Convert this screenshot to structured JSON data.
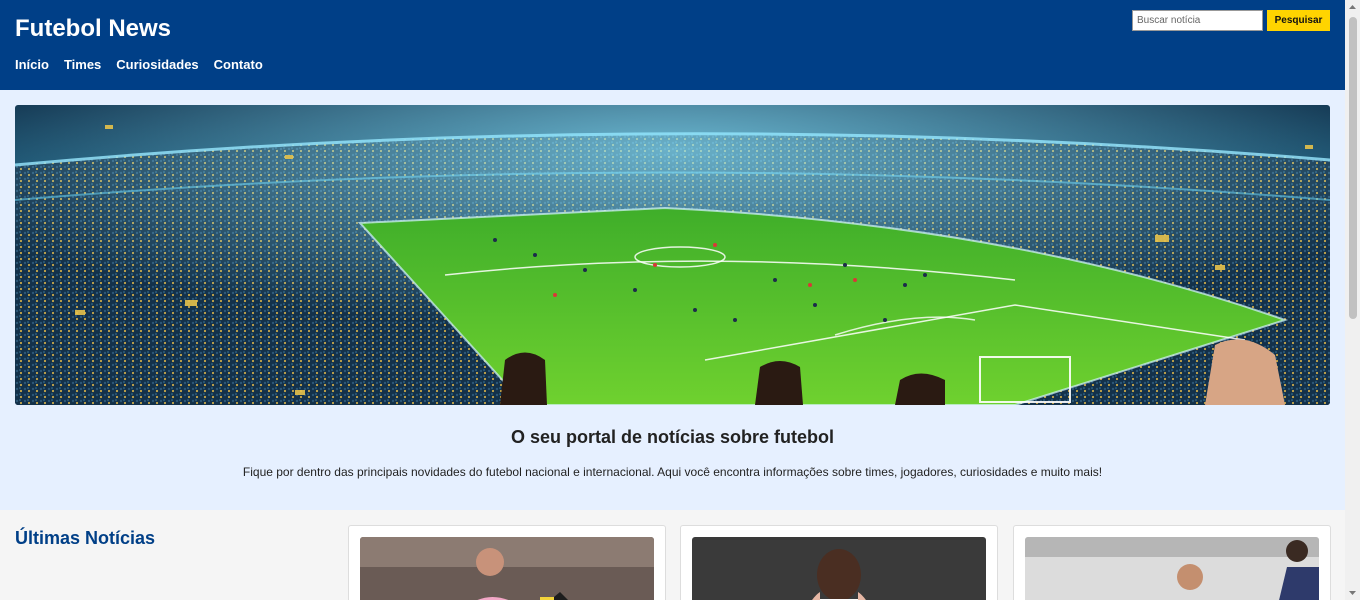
{
  "header": {
    "title": "Futebol News",
    "nav": [
      "Início",
      "Times",
      "Curiosidades",
      "Contato"
    ],
    "search": {
      "placeholder": "Buscar notícia",
      "button_label": "Pesquisar"
    }
  },
  "hero": {
    "image": "stadium-banner",
    "heading": "O seu portal de notícias sobre futebol",
    "text": "Fique por dentro das principais novidades do futebol nacional e internacional. Aqui você encontra informações sobre times, jogadores, curiosidades e muito mais!"
  },
  "news": {
    "title": "Últimas Notícias",
    "cards": [
      {
        "image": "messi-photo"
      },
      {
        "image": "player-celebration-photo"
      },
      {
        "image": "neymar-santos-photo"
      }
    ]
  },
  "colors": {
    "header_bg": "#003f87",
    "accent_button": "#ffd400",
    "hero_bg": "#e6f0ff"
  }
}
